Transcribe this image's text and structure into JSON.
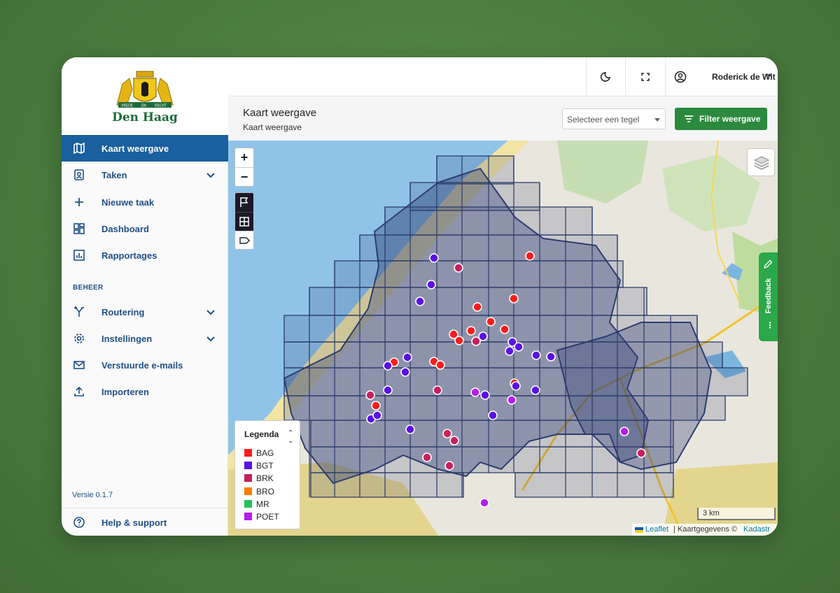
{
  "brand": {
    "name": "Den Haag",
    "motto_left": "VREDE",
    "motto_mid": "EN",
    "motto_right": "RECHT"
  },
  "sidebar": {
    "items": [
      {
        "label": "Kaart weergave",
        "active": true
      },
      {
        "label": "Taken",
        "expandable": true
      },
      {
        "label": "Nieuwe taak"
      },
      {
        "label": "Dashboard"
      },
      {
        "label": "Rapportages"
      }
    ],
    "section_title": "BEHEER",
    "admin_items": [
      {
        "label": "Routering",
        "expandable": true
      },
      {
        "label": "Instellingen",
        "expandable": true
      },
      {
        "label": "Verstuurde e-mails"
      },
      {
        "label": "Importeren"
      }
    ],
    "version": "Versie 0.1.7",
    "help": "Help & support"
  },
  "topbar": {
    "user_name": "Roderick de Wit",
    "icons": [
      "moon-icon",
      "fullscreen-icon",
      "user-circle-icon"
    ]
  },
  "page": {
    "title": "Kaart weergave",
    "subtitle": "Kaart weergave",
    "tile_select_placeholder": "Selecteer een tegel",
    "filter_button": "Filter weergave"
  },
  "map": {
    "zoom_in": "+",
    "zoom_out": "−",
    "scale": "3 km",
    "attribution": {
      "leaflet": "Leaflet",
      "text": "| Kaartgegevens ©",
      "source": "Kadastr"
    },
    "feedback": "Feedback"
  },
  "legend": {
    "title": "Legenda",
    "items": [
      {
        "name": "BAG",
        "color": "#ff1a1a"
      },
      {
        "name": "BGT",
        "color": "#5a10e8"
      },
      {
        "name": "BRK",
        "color": "#c8205a"
      },
      {
        "name": "BRO",
        "color": "#ff7a00"
      },
      {
        "name": "MR",
        "color": "#22c25a"
      },
      {
        "name": "POET",
        "color": "#b31cf2"
      }
    ]
  },
  "colors": {
    "primary": "#1a5f9e",
    "accent_green": "#2b8a3e",
    "feedback": "#2aa84a"
  }
}
